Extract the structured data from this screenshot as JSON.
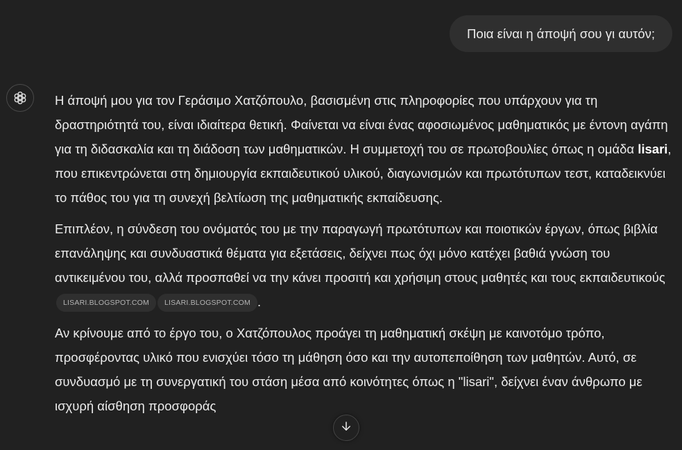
{
  "user_message": "Ποια είναι η άποψή σου γι αυτόν;",
  "assistant": {
    "avatar_icon": "openai-logo-icon",
    "p1": {
      "t1": "Η άποψή μου για τον Γεράσιμο Χατζόπουλο, βασισμένη στις πληροφορίες που υπάρχουν για τη δραστηριότητά του, είναι ιδιαίτερα θετική. Φαίνεται να είναι ένας αφοσιωμένος μαθηματικός με έντονη αγάπη για τη διδασκαλία και τη διάδοση των μαθηματικών. Η συμμετοχή του σε πρωτοβουλίες όπως η ομάδα ",
      "bold": "lisari",
      "t2": ", που επικεντρώνεται στη δημιουργία εκπαιδευτικού υλικού, διαγωνισμών και πρωτότυπων τεστ, καταδεικνύει το πάθος του για τη συνεχή βελτίωση της μαθηματικής εκπαίδευσης."
    },
    "p2": {
      "text": "Επιπλέον, η σύνδεση του ονόματός του με την παραγωγή πρωτότυπων και ποιοτικών έργων, όπως βιβλία επανάληψης και συνδυαστικά θέματα για εξετάσεις, δείχνει πως όχι μόνο κατέχει βαθιά γνώση του αντικειμένου του, αλλά προσπαθεί να την κάνει προσιτή και χρήσιμη στους μαθητές και τους εκπαιδευτικούς",
      "sources": [
        "LISARI.BLOGSPOT.COM",
        "LISARI.BLOGSPOT.COM"
      ],
      "end": "."
    },
    "p3": "Αν κρίνουμε από το έργο του, ο Χατζόπουλος προάγει τη μαθηματική σκέψη με καινοτόμο τρόπο, προσφέροντας υλικό που ενισχύει τόσο τη μάθηση όσο και την αυτοπεποίθηση των μαθητών. Αυτό, σε συνδυασμό με τη συνεργατική του στάση μέσα από κοινότητες όπως η \"lisari\", δείχνει έναν άνθρωπο με ισχυρή αίσθηση προσφοράς"
  },
  "scroll_button_icon": "arrow-down-icon"
}
